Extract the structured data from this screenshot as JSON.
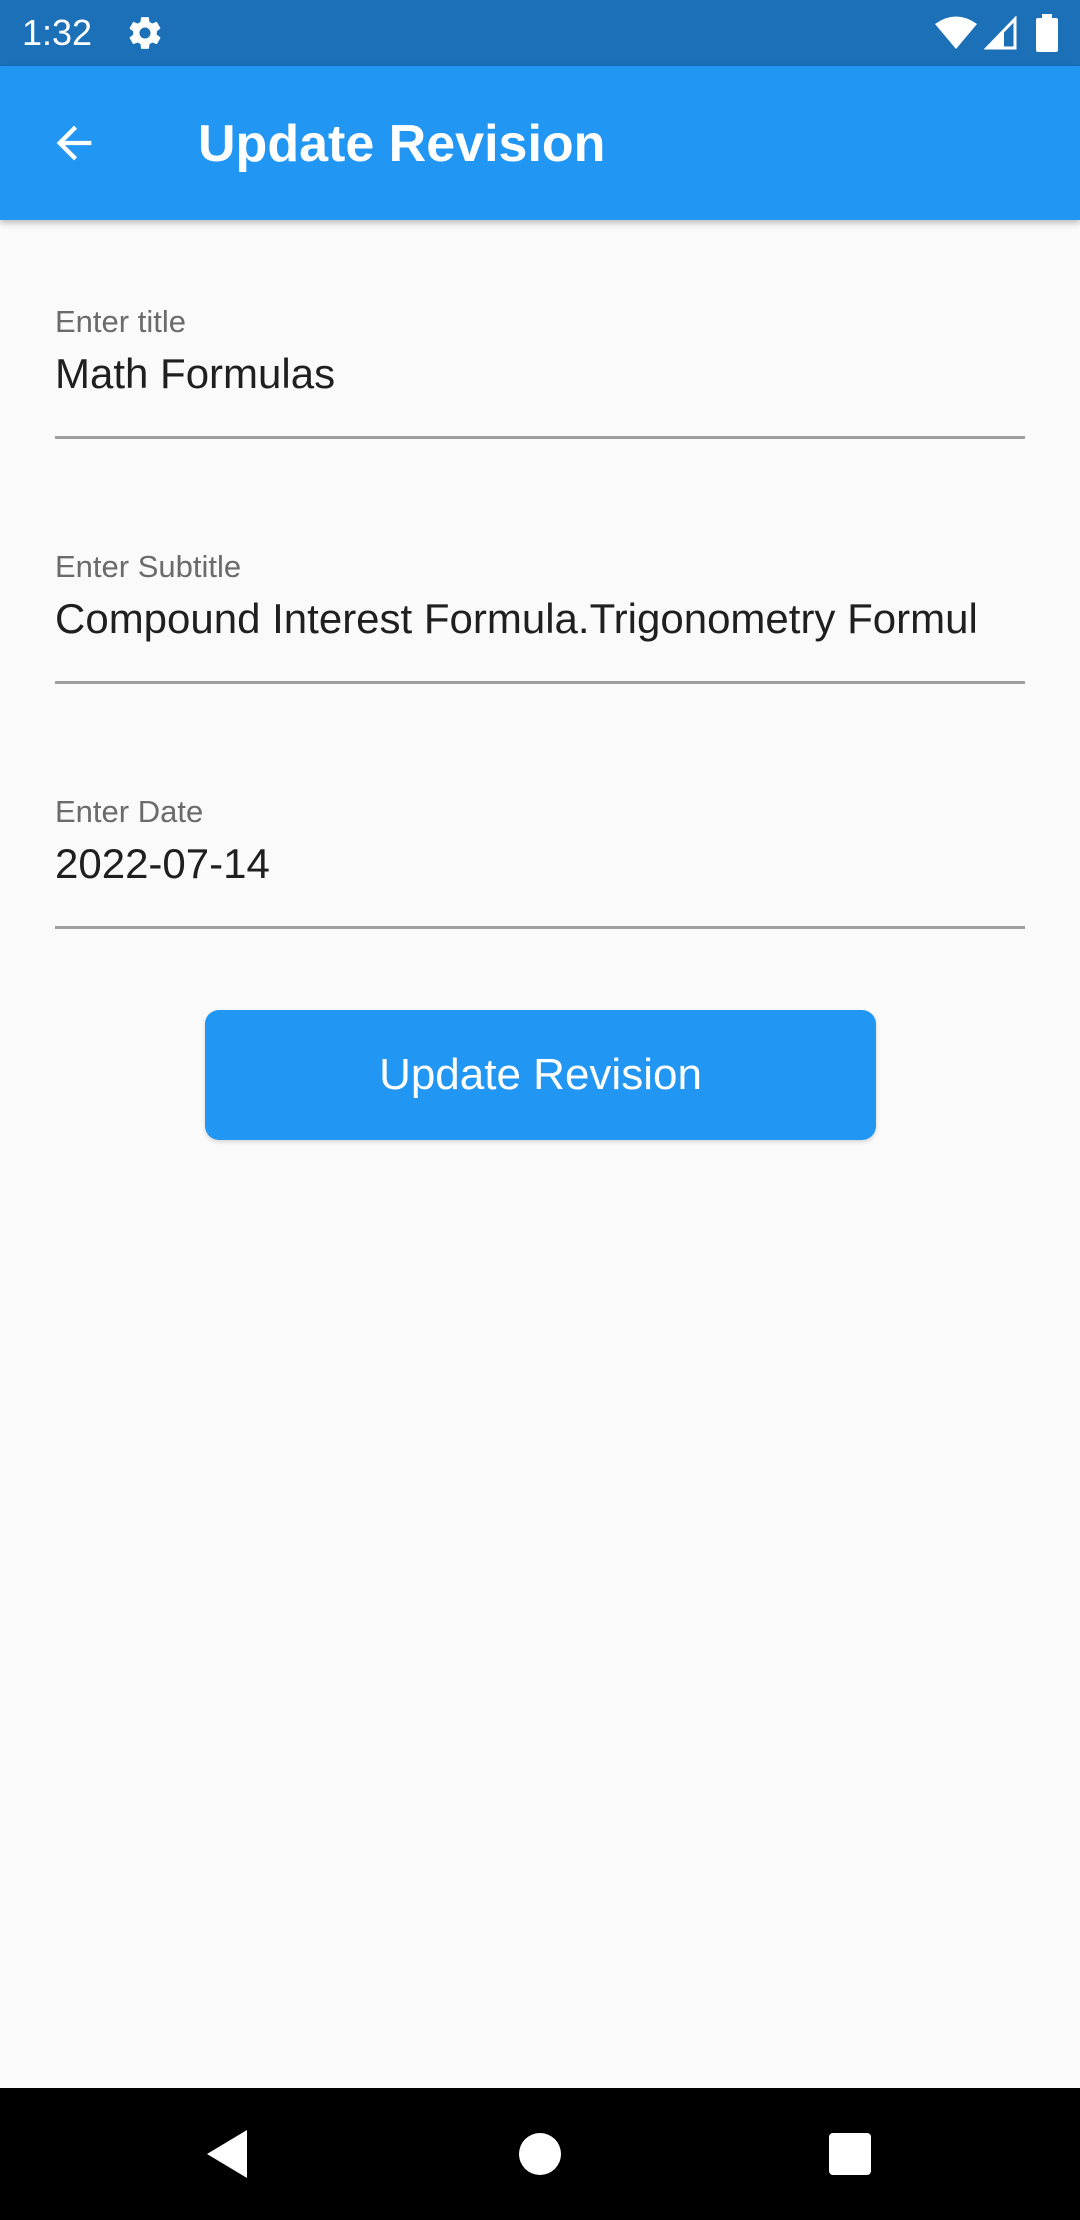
{
  "status_bar": {
    "time": "1:32",
    "icons": [
      "gear-icon",
      "wifi-icon",
      "signal-icon",
      "battery-icon"
    ]
  },
  "app_bar": {
    "title": "Update Revision",
    "back_icon": "arrow-back-icon",
    "color": "#2196f3"
  },
  "form": {
    "title_field": {
      "label": "Enter title",
      "value": "Math Formulas"
    },
    "subtitle_field": {
      "label": "Enter Subtitle",
      "value": "Compound Interest Formula.Trigonometry Formul"
    },
    "date_field": {
      "label": "Enter Date",
      "value": "2022-07-14"
    },
    "submit_label": "Update Revision"
  },
  "nav_bar": {
    "icons": [
      "back-triangle-icon",
      "home-circle-icon",
      "recents-square-icon"
    ]
  },
  "colors": {
    "status_bar": "#1b70b8",
    "accent": "#2196f3",
    "background": "#fafafa",
    "nav_bar": "#000000"
  }
}
